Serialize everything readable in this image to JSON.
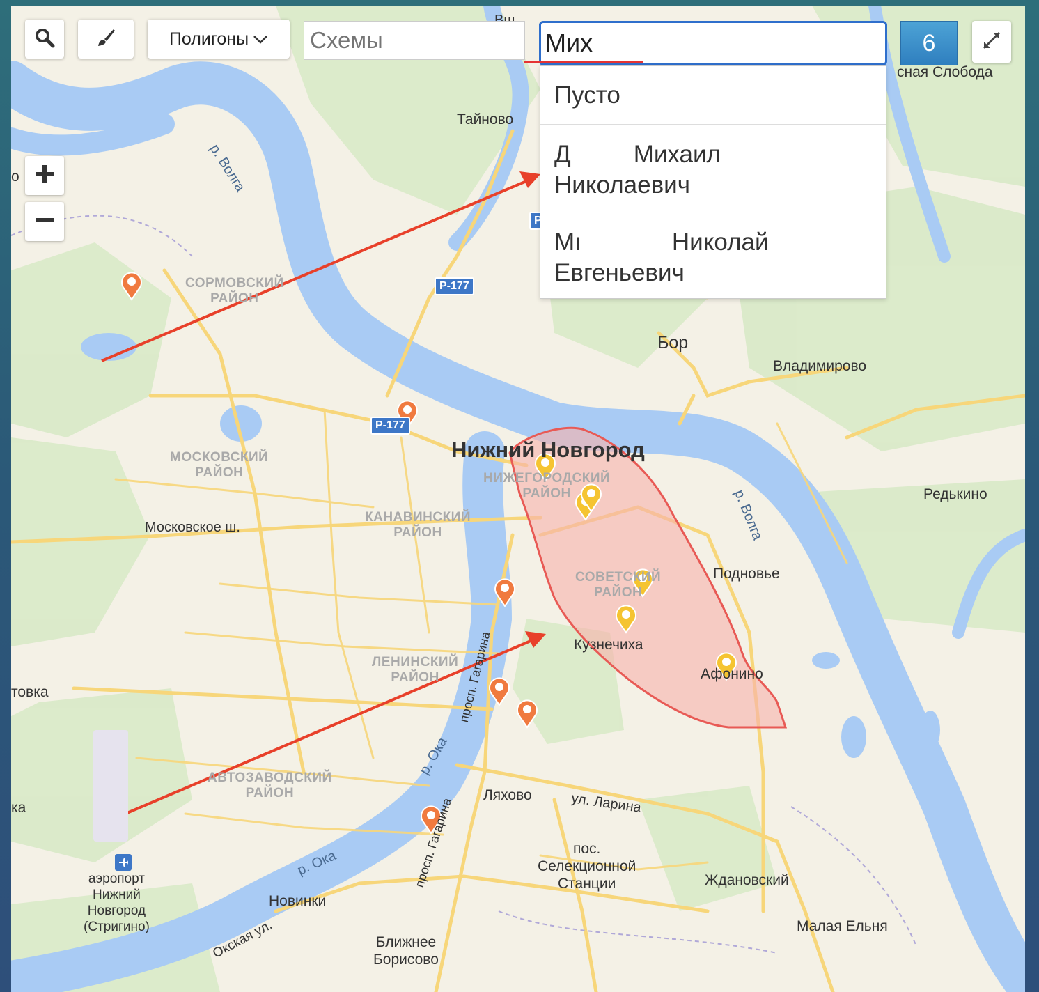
{
  "toolbar": {
    "search_icon": "search-icon",
    "brush_icon": "brush-icon",
    "polygons_label": "Полигоны",
    "schemes_placeholder": "Схемы",
    "search_value": "Мих",
    "result_count": "6",
    "fullscreen_icon": "fullscreen-icon"
  },
  "zoom": {
    "in_icon": "plus-icon",
    "out_icon": "minus-icon"
  },
  "dropdown": {
    "items": [
      {
        "line1": "Пусто",
        "line2": ""
      },
      {
        "line1_prefix": "Д",
        "line1_name": "Михаил",
        "line2": "Николаевич"
      },
      {
        "line1_prefix": "Мı",
        "line1_name": "Николай",
        "line2": "Евгеньевич"
      }
    ]
  },
  "map": {
    "labels": {
      "city": "Нижний Новгород",
      "bor": "Бор",
      "tainovo": "Тайново",
      "krasnaya_sloboda": "сная Слобода",
      "vladimirovo": "Владимирово",
      "redkino": "Редькино",
      "podnovye": "Подновье",
      "kuznechikha": "Кузнечиха",
      "afonino": "Афонино",
      "lyakhovo": "Ляхово",
      "zhdanovsky": "Ждановский",
      "malaya_elnya": "Малая Ельня",
      "novinki": "Новинки",
      "blizhnee_borisovo": "Ближнее\nБорисово",
      "selekts": "пос.\nСелекционной\nСтанции",
      "airport": "аэропорт\nНижний\nНовгород\n(Стригино)",
      "tovka": "товка",
      "ka": "ка",
      "o_left": "о",
      "moskovskoe_sh": "Московское ш.",
      "ul_larina": "ул. Ларина",
      "okskaya_ul": "Окская ул.",
      "pr_gagarina_1": "просп. Гагарина",
      "pr_gagarina_2": "просп. Гагарина",
      "r_volga_1": "р. Волга",
      "r_volga_2": "р. Волга",
      "r_oka_1": "р. Ока",
      "r_oka_2": "р. Ока",
      "top_vsh": "Вш"
    },
    "districts": {
      "sormovsky": "СОРМОВСКИЙ\nРАЙОН",
      "moskovsky": "МОСКОВСКИЙ\nРАЙОН",
      "kanavinsky": "КАНАВИНСКИЙ\nРАЙОН",
      "nizhegorodsky": "НИЖЕГОРОДСКИЙ\nРАЙОН",
      "sovetsky": "СОВЕТСКИЙ\nРАЙОН",
      "leninsky": "ЛЕНИНСКИЙ\nРАЙОН",
      "avtozavodsky": "АВТОЗАВОДСКИЙ\nРАЙОН"
    },
    "road_badges": {
      "r177_a": "Р-177",
      "r177_b": "Р-177",
      "r_partial": "Р"
    },
    "colors": {
      "water": "#a9cbf4",
      "forest": "#d6e8c4",
      "road": "#f7d67a",
      "polygon_fill": "#f7b3ad",
      "polygon_stroke": "#e85a55",
      "pin_orange": "#f07a3f",
      "pin_yellow": "#f5c431",
      "arrow": "#e8402a",
      "count_button": "#3a8fca"
    }
  }
}
